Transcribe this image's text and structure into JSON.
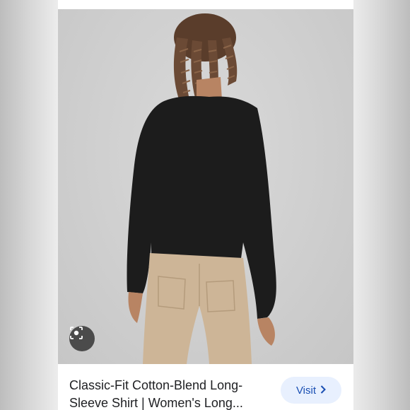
{
  "product": {
    "title": "Classic-Fit Cotton-Blend Long-Sleeve Shirt | Women's Long..."
  },
  "actions": {
    "visit_label": "Visit",
    "visit_icon": "chevron-right-icon",
    "lens_icon": "image-search-icon"
  },
  "colors": {
    "visit_bg": "#e8f0fe",
    "visit_text": "#1a4fb3",
    "shirt": "#1c1c1c",
    "pants": "#cdb597"
  }
}
